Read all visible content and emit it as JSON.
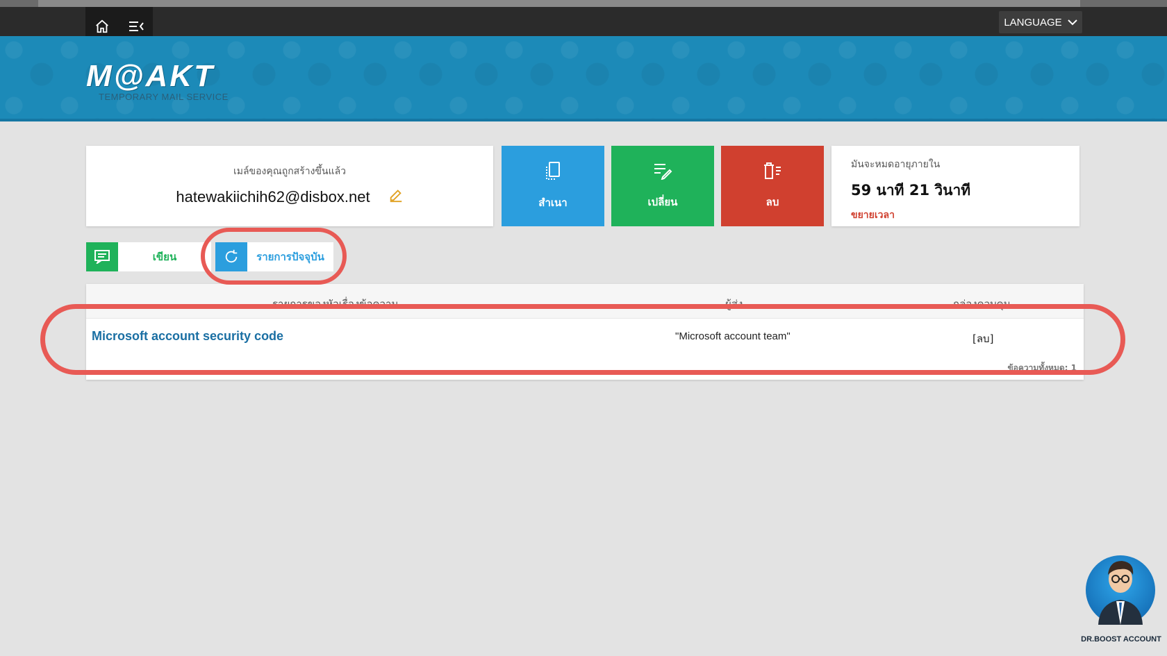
{
  "topbar": {
    "language_label": "LANGUAGE"
  },
  "brand": {
    "logo_text": "M@AKT",
    "subtitle": "TEMPORARY MAIL SERVICE"
  },
  "mail": {
    "label": "เมล์ของคุณถูกสร้างขึ้นแล้ว",
    "address": "hatewakiichih62@disbox.net"
  },
  "actions": {
    "copy_label": "สำเนา",
    "change_label": "เปลี่ยน",
    "delete_label": "ลบ"
  },
  "timer": {
    "label": "มันจะหมดอายุภายใน",
    "value": "59 นาที 21 วินาที",
    "extend_label": "ขยายเวลา"
  },
  "tabs": {
    "write_label": "เขียน",
    "refresh_label": "รายการปัจจุบัน"
  },
  "table": {
    "headers": [
      "รายการของหัวเรื่องข้อความ",
      "ผู้ส่ง",
      "กล่องควบคุม"
    ],
    "rows": [
      {
        "subject": "Microsoft account security code",
        "sender": "\"Microsoft account team\"",
        "control": "[ลบ]"
      }
    ],
    "footer": "ข้อความทั้งหมด: 1"
  },
  "badge": {
    "label": "DR.BOOST ACCOUNT"
  },
  "colors": {
    "header_blue": "#1c8ab8",
    "copy_blue": "#2b9ede",
    "change_green": "#1fb25a",
    "delete_red": "#d0402f",
    "highlight_red": "#e85a55"
  }
}
